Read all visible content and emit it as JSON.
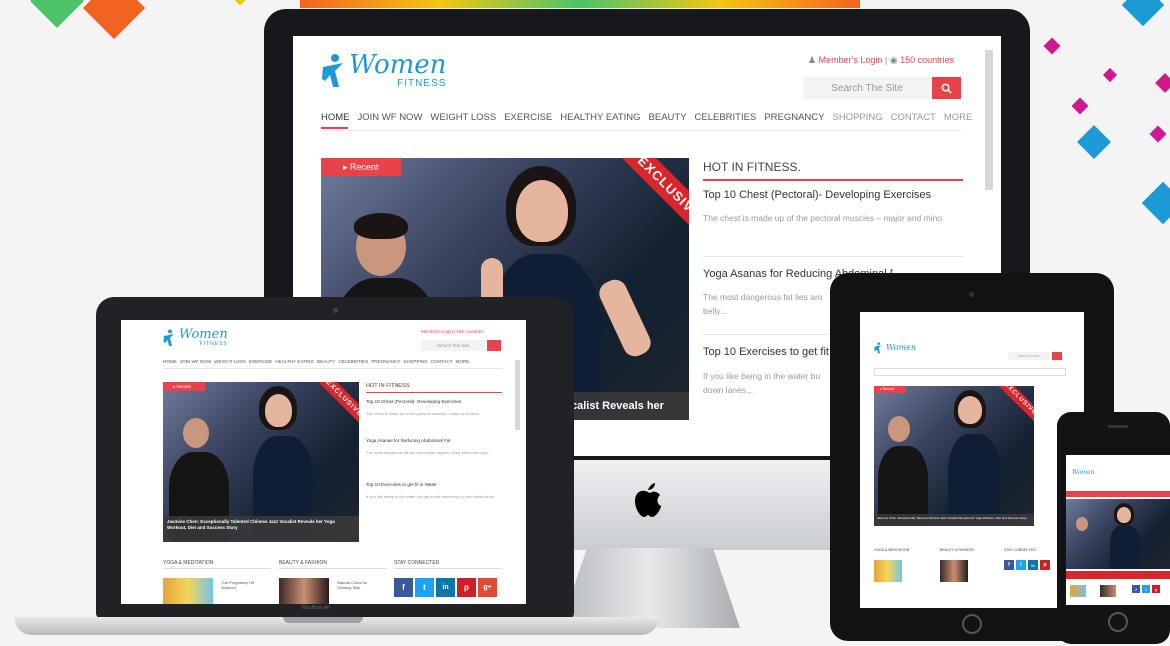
{
  "site": {
    "logo_word": "Women",
    "logo_sub": "FITNESS",
    "member_login": "Member's Login",
    "countries": "150 countries",
    "search_placeholder": "Search The Site",
    "nav": [
      "HOME",
      "JOIN WF NOW",
      "WEIGHT LOSS",
      "EXERCISE",
      "HEALTHY EATING",
      "BEAUTY",
      "CELEBRITIES",
      "PREGNANCY",
      "SHOPPING",
      "CONTACT",
      "MORE"
    ],
    "recent_tag": "Recent",
    "exclusive": "EXCLUSIVE",
    "hero_caption_large": "calist Reveals her",
    "hero_caption_small": "Jasmine Chen: Exceptionally Talented Chinese Jazz Vocalist Reveals her Yoga Workout, Diet and Success Story",
    "hot_title": "HOT IN FITNESS.",
    "articles": [
      {
        "title": "Top 10 Chest (Pectoral)- Developing Exercises",
        "desc": "The chest is made up of the pectoral muscles - major and minor."
      },
      {
        "title": "Yoga Asanas for Reducing Abdominal Fat",
        "desc": "The most dangerous fat lies around the organs, deep within the belly..."
      },
      {
        "title": "Top 10 Exercises to get fit in Water",
        "desc": "If you like being in the water but get bored swimming up and down lanes..."
      }
    ],
    "large_article_titles": [
      "Top 10 Chest (Pectoral)- Developing Exercises",
      "Yoga Asanas for Reducing Abdominal Fat",
      "Top 10 Exercises to get fit i"
    ],
    "large_article_descs": [
      "The chest is made up of the pectoral muscles – major and mino",
      "The most dangerous fat lies aro",
      "belly...",
      "If you like being in the water bu",
      "down lanes..."
    ],
    "sections": [
      "YOGA & MEDITATION",
      "BEAUTY & FASHION",
      "STAY CONNECTED"
    ],
    "yoga_item": "The Pregnancy Hit Workout",
    "beauty_item": "Natural Cures for Glowing Skin"
  },
  "devices": {
    "laptop_label": "MacBook Air"
  },
  "colors": {
    "accent": "#e8434a",
    "brand_blue": "#1b9ad6",
    "facebook": "#3b5998",
    "twitter": "#1da1f2",
    "linkedin": "#0e76a8",
    "pinterest": "#cb2027",
    "googleplus": "#dd4b39"
  },
  "social_icons": [
    "f",
    "t",
    "in",
    "p",
    "g+"
  ]
}
